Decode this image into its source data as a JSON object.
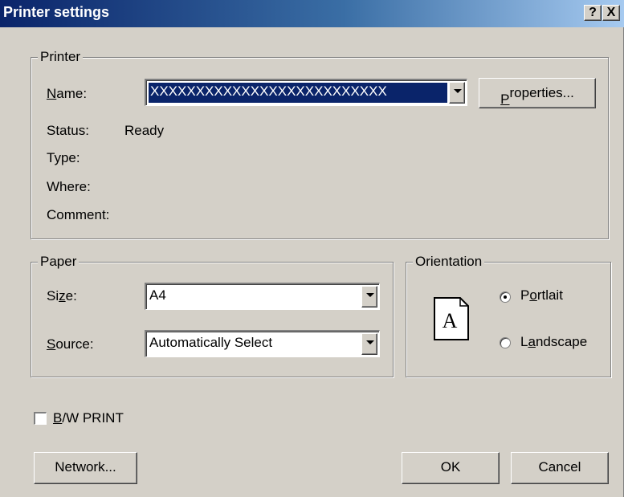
{
  "window": {
    "title": "Printer settings",
    "help_btn": "?",
    "close_btn": "X"
  },
  "printer": {
    "legend": "Printer",
    "name_label": "Name:",
    "name_value": "XXXXXXXXXXXXXXXXXXXXXXXXXX",
    "properties_button": "Properties...",
    "status_label": "Status:",
    "status_value": "Ready",
    "type_label": "Type:",
    "where_label": "Where:",
    "comment_label": "Comment:"
  },
  "paper": {
    "legend": "Paper",
    "size_label": "Size:",
    "size_value": "A4",
    "source_label": "Source:",
    "source_value": "Automatically Select"
  },
  "orientation": {
    "legend": "Orientation",
    "page_glyph": "A",
    "portrait_label": "Portlait",
    "landscape_label": "Landscape",
    "selected": "portrait"
  },
  "bw_print": {
    "label": "B/W PRINT",
    "checked": false
  },
  "buttons": {
    "network": "Network...",
    "ok": "OK",
    "cancel": "Cancel"
  }
}
